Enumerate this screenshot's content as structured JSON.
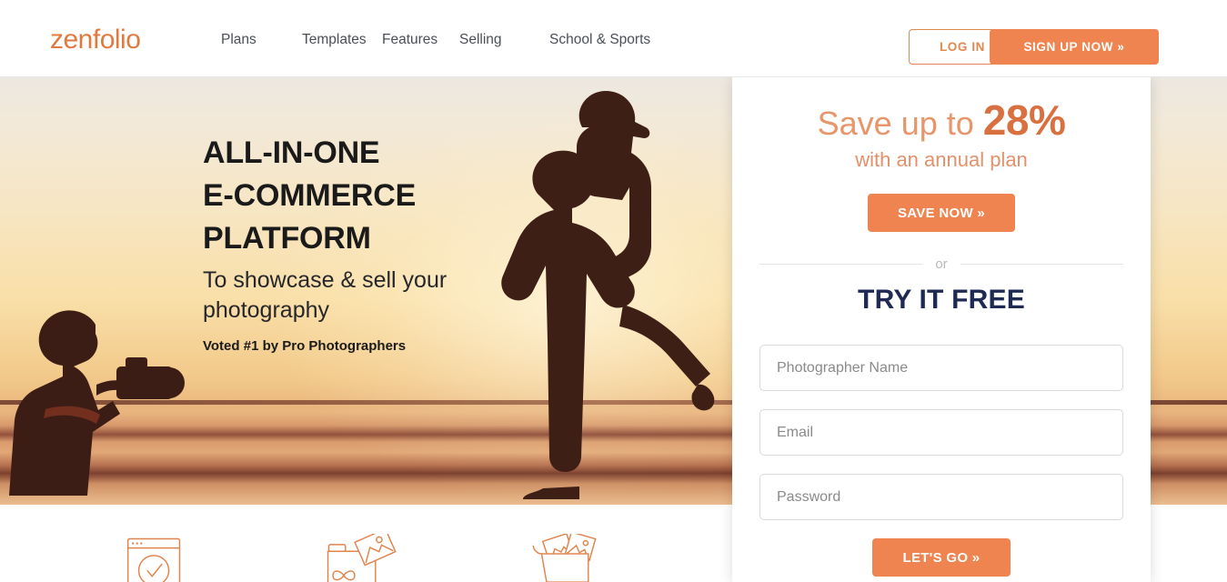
{
  "header": {
    "logo_text": "zenfolio",
    "logo_color": "#e07a3f",
    "nav_items": [
      {
        "label": "Plans"
      },
      {
        "label": "Templates"
      },
      {
        "label": "Features"
      },
      {
        "label": "Selling"
      },
      {
        "label": "School & Sports"
      }
    ],
    "login_label": "LOG IN",
    "signup_label": "SIGN UP NOW »"
  },
  "hero": {
    "headline_line1": "ALL-IN-ONE",
    "headline_line2": "E-COMMERCE",
    "headline_line3": "PLATFORM",
    "subhead_line1": "To showcase & sell your",
    "subhead_line2": "photography",
    "voted": "Voted #1 by Pro Photographers",
    "image_description": "sunset-beach-silhouette-photo"
  },
  "signup": {
    "save_prefix": "Save up to ",
    "save_percent": "28%",
    "annual_note": "with an annual plan",
    "save_now_label": "SAVE NOW »",
    "or_label": "or",
    "try_free_title": "TRY IT FREE",
    "fields": [
      {
        "name": "photographer-name",
        "placeholder": "Photographer Name",
        "value": ""
      },
      {
        "name": "email",
        "placeholder": "Email",
        "value": ""
      },
      {
        "name": "password",
        "placeholder": "Password",
        "value": ""
      }
    ],
    "submit_label": "LET'S GO »",
    "accent_color": "#ef8450",
    "title_color": "#1f2a54"
  },
  "features": {
    "icon_color": "#e0854f",
    "items": [
      {
        "icon": "browser-window-check-icon"
      },
      {
        "icon": "folder-infinity-photos-icon"
      },
      {
        "icon": "shopping-cart-photos-icon"
      }
    ]
  }
}
